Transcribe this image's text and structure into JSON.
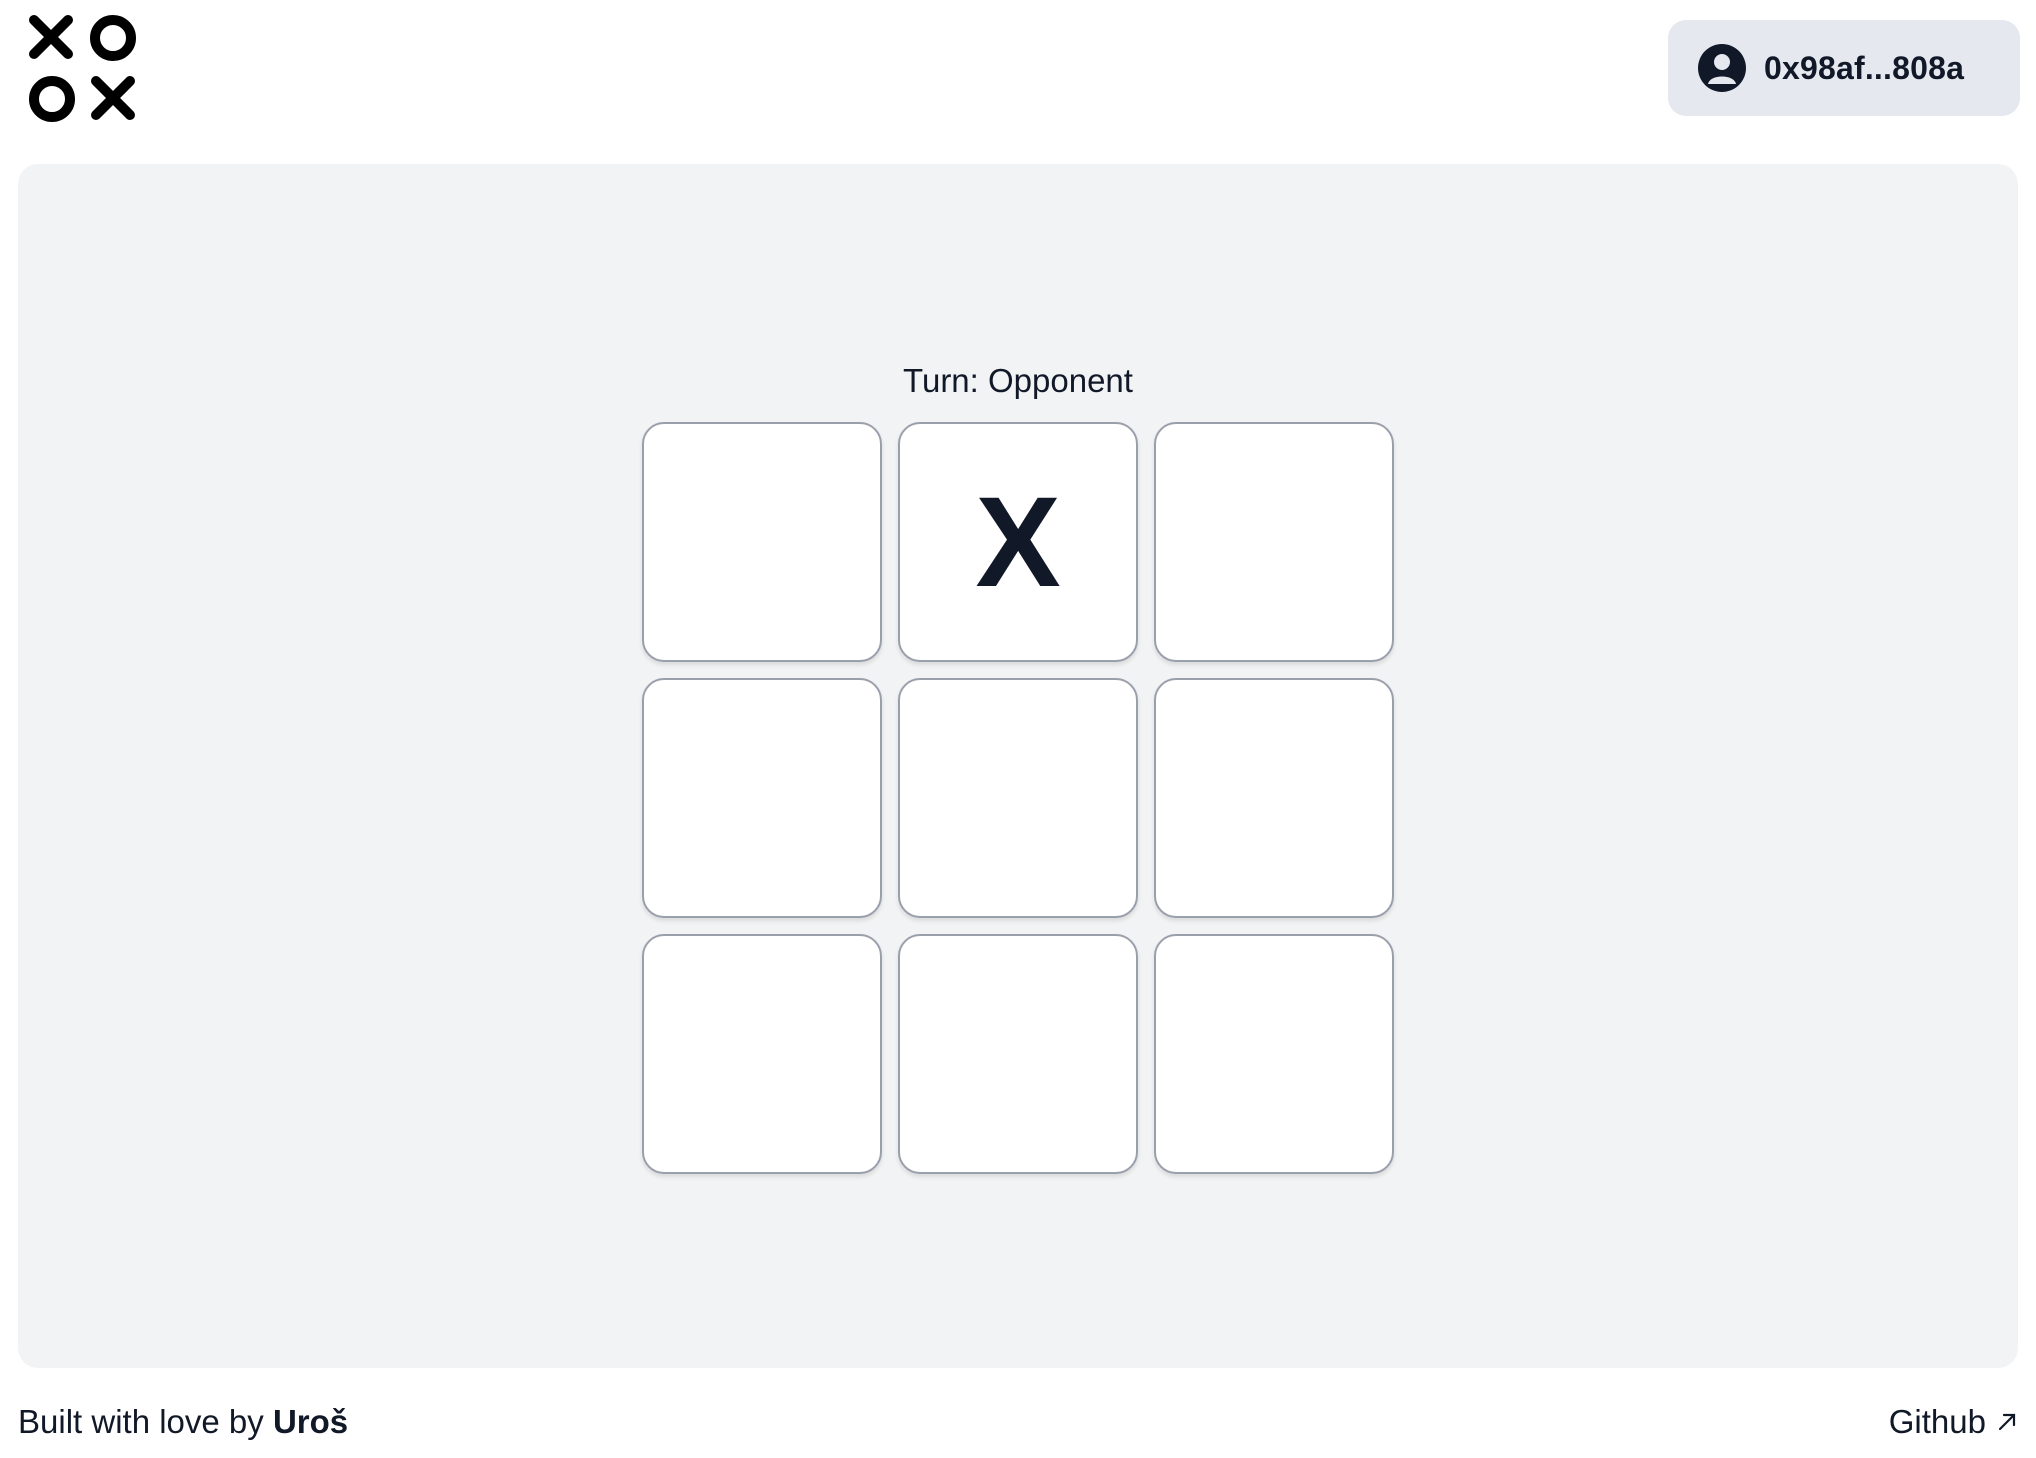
{
  "header": {
    "logo_icon": "xoox-logo-icon",
    "wallet": {
      "icon": "user-avatar-icon",
      "address": "0x98af...808a"
    }
  },
  "game": {
    "turn_label": "Turn: Opponent",
    "board": [
      "",
      "X",
      "",
      "",
      "",
      "",
      "",
      "",
      ""
    ]
  },
  "footer": {
    "credit_prefix": "Built with love by ",
    "credit_name": "Uroš",
    "github_label": "Github",
    "github_icon": "arrow-up-right-icon"
  }
}
